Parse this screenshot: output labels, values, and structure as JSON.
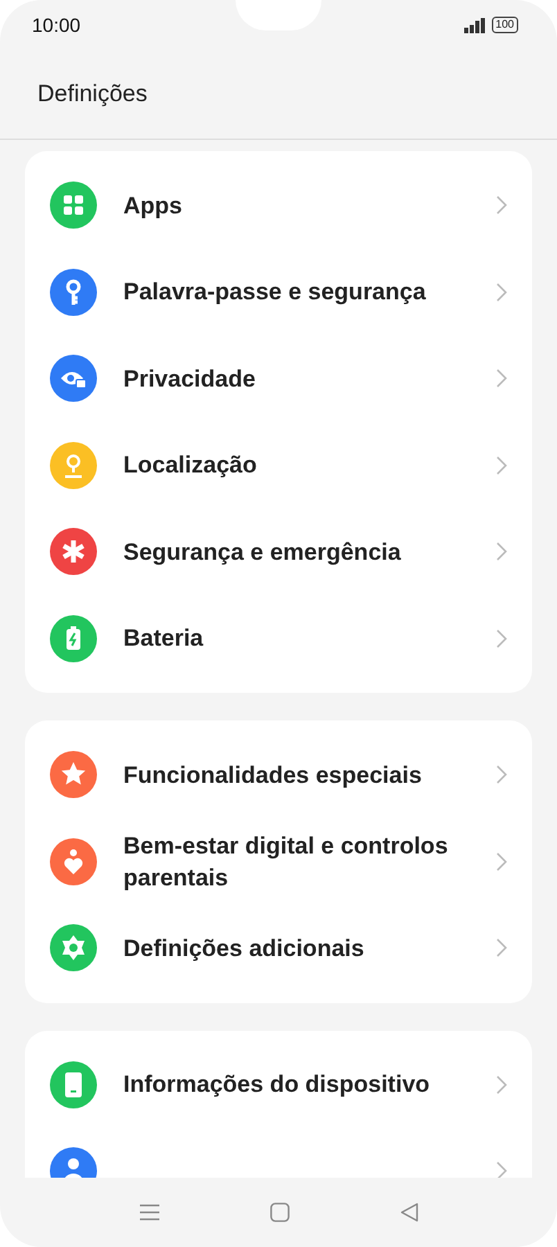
{
  "status_bar": {
    "time": "10:00",
    "battery": "100"
  },
  "header": {
    "title": "Definições"
  },
  "groups": [
    {
      "items": [
        {
          "kind": "apps",
          "label": "Apps",
          "color": "#22c55e"
        },
        {
          "kind": "key",
          "label": "Palavra-passe e segurança",
          "color": "#2f7bf5"
        },
        {
          "kind": "privacy",
          "label": "Privacidade",
          "color": "#2f7bf5"
        },
        {
          "kind": "location",
          "label": "Localização",
          "color": "#fbbf24"
        },
        {
          "kind": "emergency",
          "label": "Segurança e emergência",
          "color": "#ef4444"
        },
        {
          "kind": "battery",
          "label": "Bateria",
          "color": "#22c55e"
        }
      ]
    },
    {
      "items": [
        {
          "kind": "star",
          "label": "Funcionalidades especiais",
          "color": "#fb6a44"
        },
        {
          "kind": "wellbeing",
          "label": "Bem-estar digital e controlos parentais",
          "color": "#fb6a44"
        },
        {
          "kind": "gear",
          "label": "Definições adicionais",
          "color": "#22c55e"
        }
      ]
    },
    {
      "items": [
        {
          "kind": "device",
          "label": "Informações do dispositivo",
          "color": "#22c55e"
        },
        {
          "kind": "user",
          "color": "#2f7bf5"
        }
      ]
    }
  ]
}
